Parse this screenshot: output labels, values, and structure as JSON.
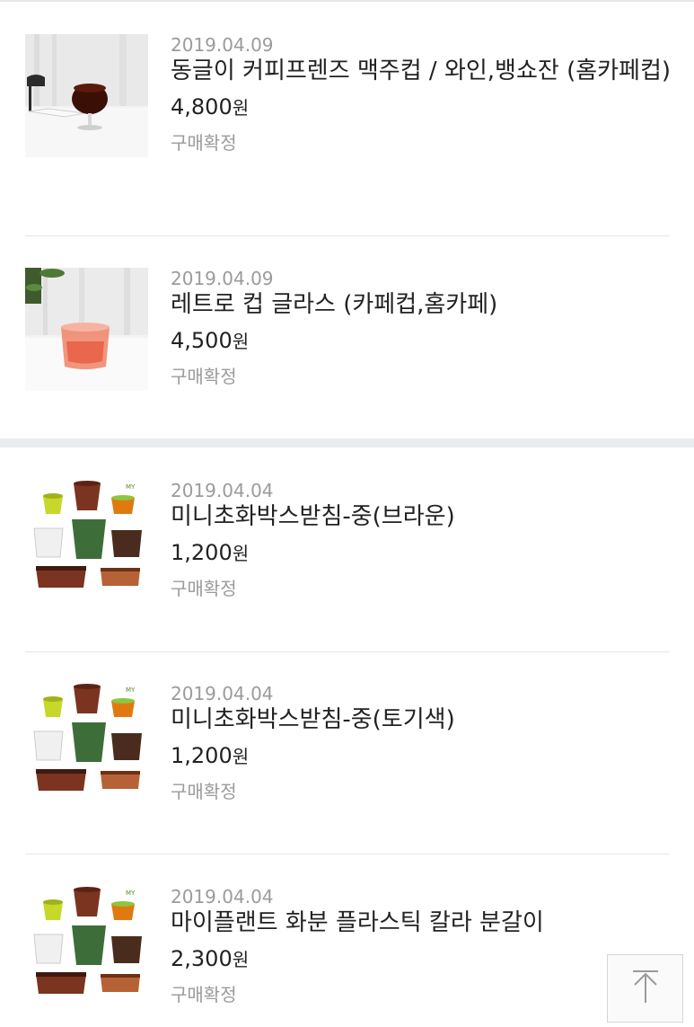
{
  "orders": [
    {
      "date": "2019.04.09",
      "name": "동글이 커피프렌즈 맥주컵 / 와인,뱅쇼잔 (홈카페컵)",
      "price": "4,800",
      "currency": "원",
      "status": "구매확정",
      "image": "glass-cup-photo"
    },
    {
      "date": "2019.04.09",
      "name": "레트로 컵 글라스 (카페컵,홈카페)",
      "price": "4,500",
      "currency": "원",
      "status": "구매확정",
      "image": "retro-glass-photo"
    },
    {
      "date": "2019.04.04",
      "name": "미니초화박스받침-중(브라운)",
      "price": "1,200",
      "currency": "원",
      "status": "구매확정",
      "image": "plant-pots-photo"
    },
    {
      "date": "2019.04.04",
      "name": "미니초화박스받침-중(토기색)",
      "price": "1,200",
      "currency": "원",
      "status": "구매확정",
      "image": "plant-pots-photo"
    },
    {
      "date": "2019.04.04",
      "name": "마이플랜트 화분 플라스틱 칼라 분갈이",
      "price": "2,300",
      "currency": "원",
      "status": "구매확정",
      "image": "plant-pots-photo"
    }
  ],
  "scroll_top_icon": "arrow-up-icon"
}
